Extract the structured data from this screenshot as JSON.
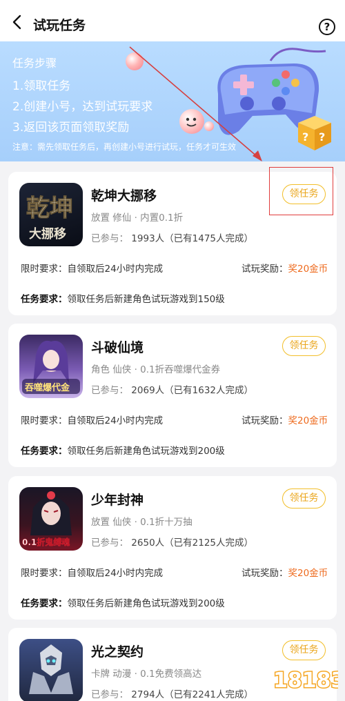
{
  "header": {
    "title": "试玩任务",
    "help_symbol": "?"
  },
  "banner": {
    "title": "任务步骤",
    "steps": [
      "1.领取任务",
      "2.创建小号，达到试玩要求",
      "3.返回该页面领取奖励"
    ],
    "note": "注意：需先领取任务后，再创建小号进行试玩，任务才可生效"
  },
  "labels": {
    "participants_prefix": "已参与：",
    "time_req_prefix": "限时要求：",
    "reward_prefix": "试玩奖励：",
    "task_req_prefix": "任务要求：",
    "task_button": "领任务"
  },
  "games": [
    {
      "name": "乾坤大挪移",
      "tags": "放置 修仙 · 内置0.1折",
      "participants": "1993人",
      "completed": "（已有1475人完成）",
      "time_req": "自领取后24小时内完成",
      "reward": "奖20金币",
      "task": "领取任务后新建角色试玩游戏到150级",
      "icon_text": "乾坤"
    },
    {
      "name": "斗破仙境",
      "tags": "角色 仙侠 · 0.1折吞噬爆代金券",
      "participants": "2069人",
      "completed": "（已有1632人完成）",
      "time_req": "自领取后24小时内完成",
      "reward": "奖20金币",
      "task": "领取任务后新建角色试玩游戏到200级",
      "icon_text": "吞噬爆代金"
    },
    {
      "name": "少年封神",
      "tags": "放置 仙侠 · 0.1折十万抽",
      "participants": "2650人",
      "completed": "（已有2125人完成）",
      "time_req": "自领取后24小时内完成",
      "reward": "奖20金币",
      "task": "领取任务后新建角色试玩游戏到200级",
      "icon_text": "0.1折鬼缚魂"
    },
    {
      "name": "光之契约",
      "tags": "卡牌 动漫 · 0.1免费领高达",
      "participants": "2794人",
      "completed": "（已有2241人完成）",
      "time_req": "",
      "reward": "",
      "task": "",
      "icon_text": ""
    }
  ],
  "watermark": "18183",
  "colors": {
    "accent": "#f2be28",
    "reward": "#ee6a1d",
    "highlight": "#e03b3b",
    "banner": "#b9dcff"
  }
}
